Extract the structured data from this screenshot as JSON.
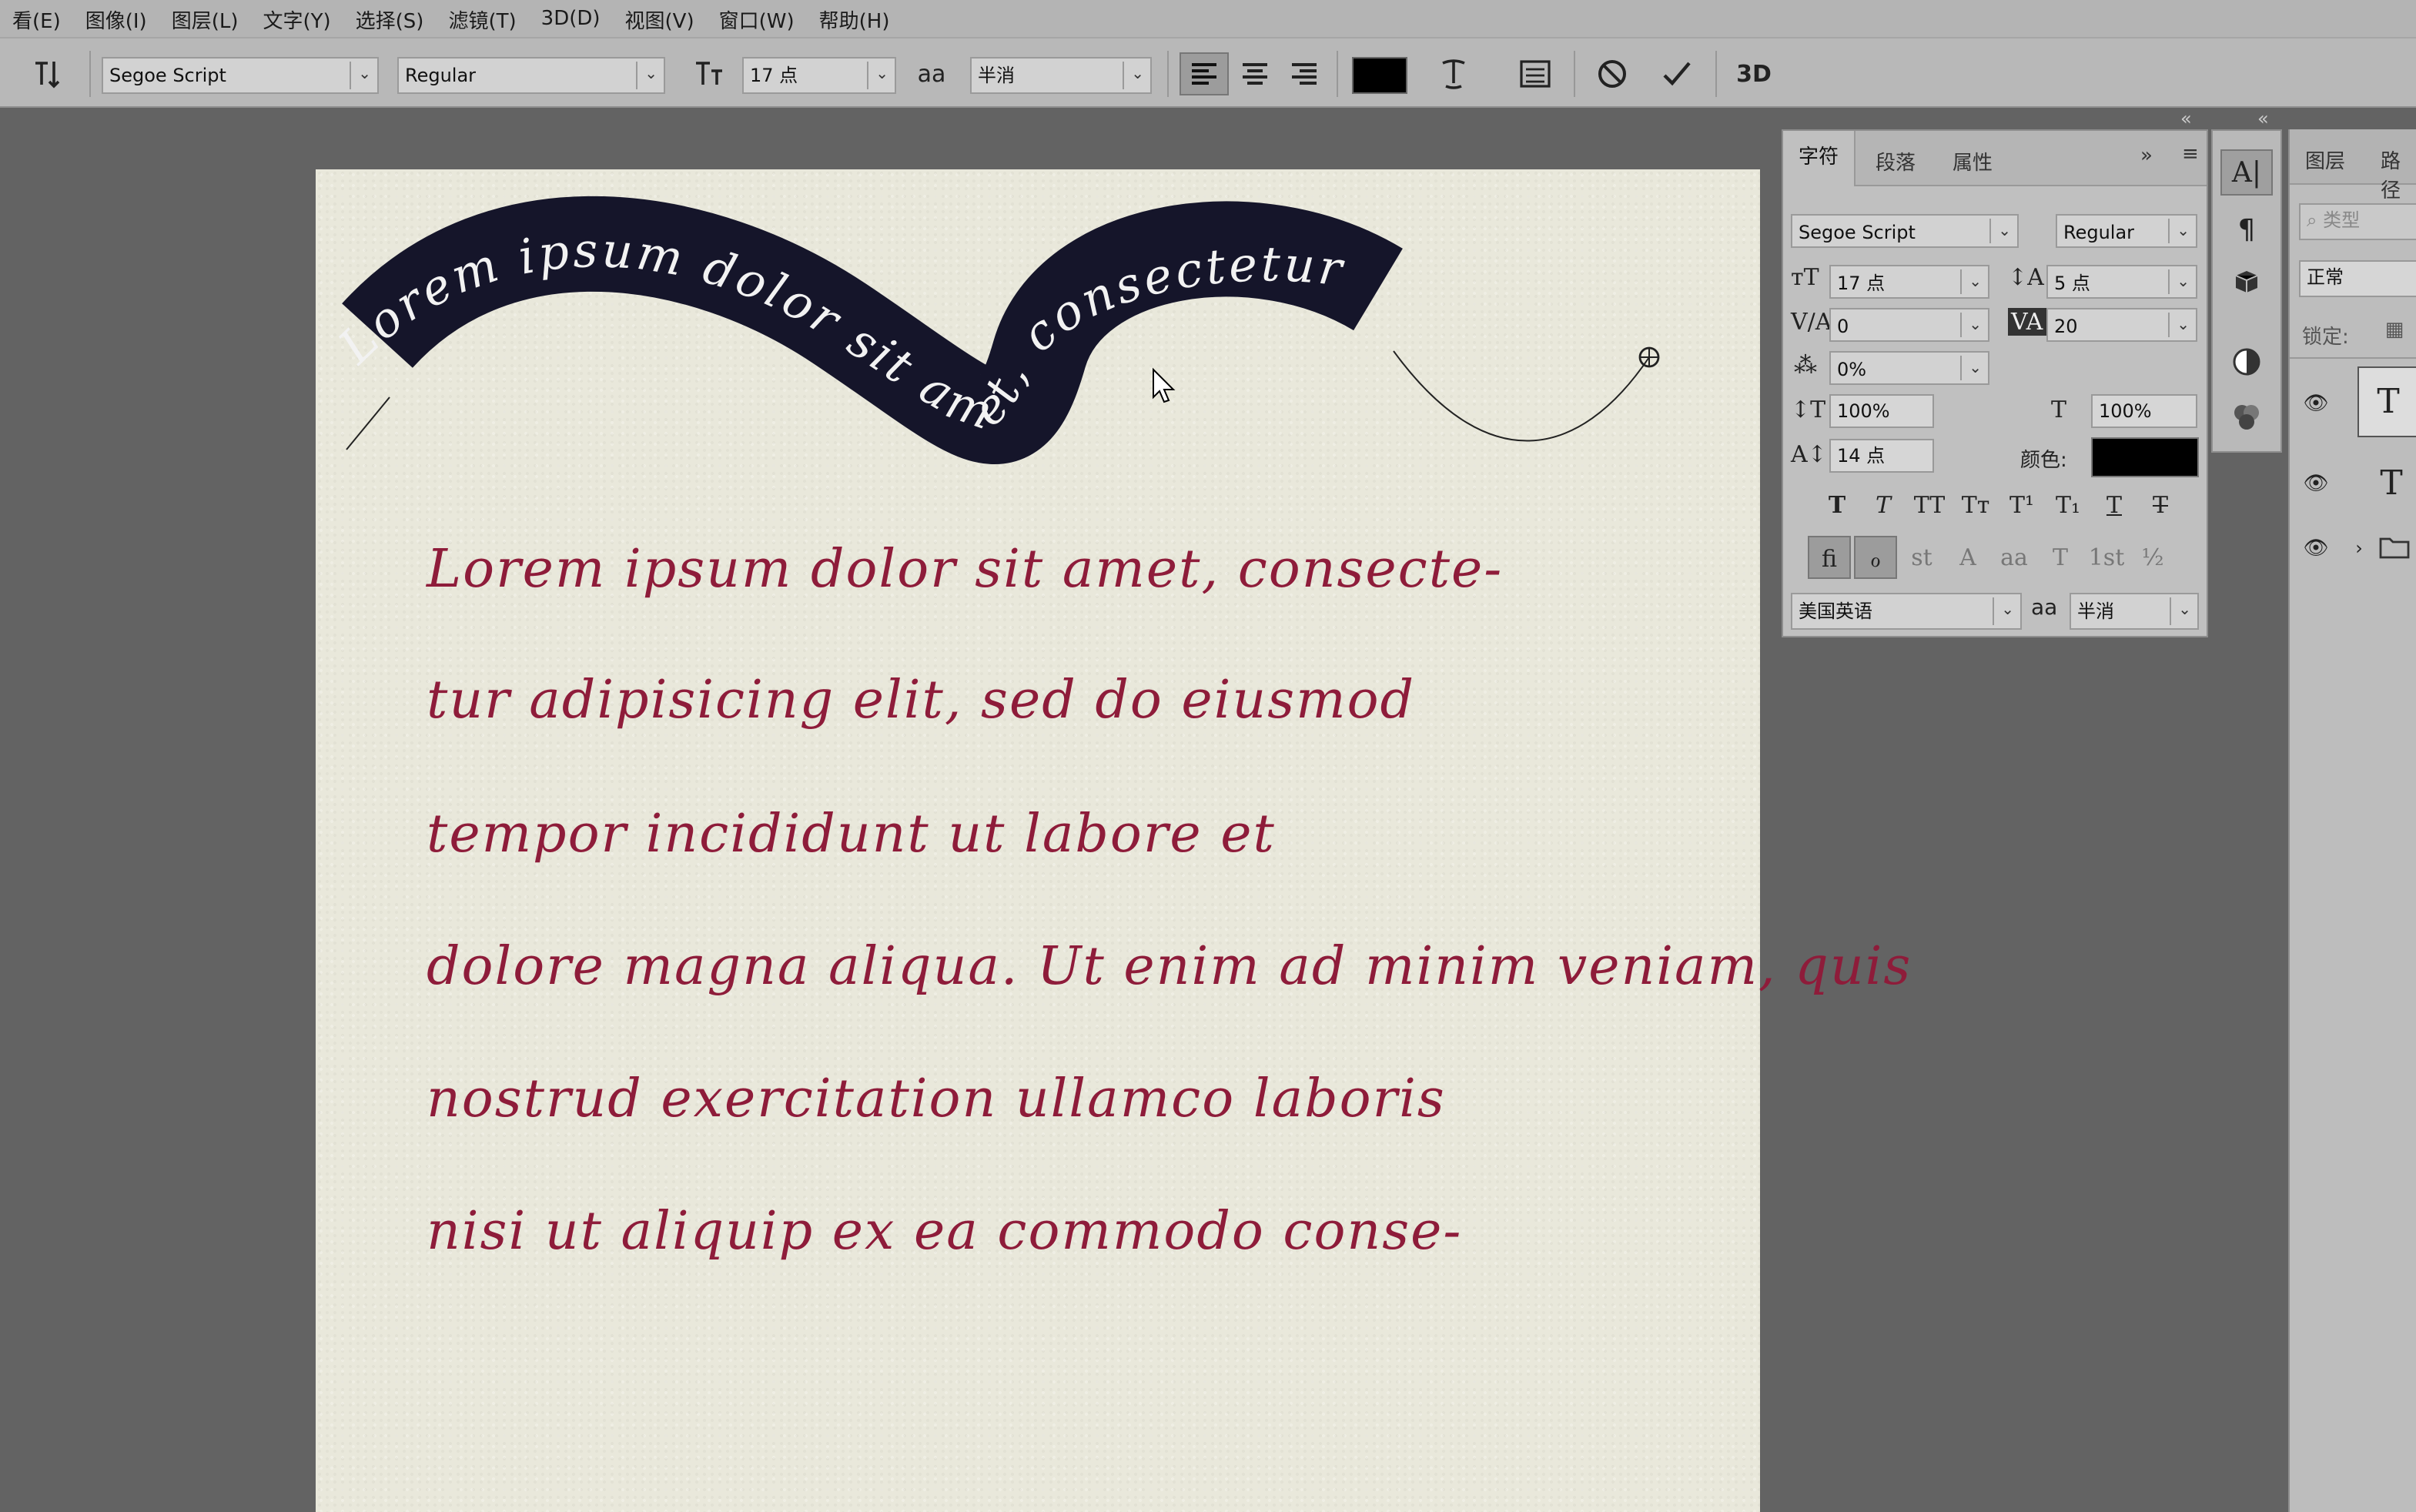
{
  "menu": [
    "看(E)",
    "图像(I)",
    "图层(L)",
    "文字(Y)",
    "选择(S)",
    "滤镜(T)",
    "3D(D)",
    "视图(V)",
    "窗口(W)",
    "帮助(H)"
  ],
  "options": {
    "font_family": "Segoe Script",
    "font_style": "Regular",
    "font_size": "17 点",
    "aa_icon": "aa",
    "anti_alias": "半消",
    "threed": "3D"
  },
  "path_text": "Lorem ipsum dolor sit amet, consectetur",
  "body_lines": [
    "Lorem ipsum dolor sit amet, consecte-",
    "tur adipisicing elit, sed do eiusmod",
    "tempor incididunt ut labore et",
    "dolore magna aliqua. Ut enim ad minim veniam, quis",
    "nostrud exercitation ullamco laboris",
    "nisi ut aliquip ex ea commodo conse-"
  ],
  "character_panel": {
    "tabs": [
      "字符",
      "段落",
      "属性"
    ],
    "font_family": "Segoe Script",
    "font_style": "Regular",
    "size": "17 点",
    "leading": "5 点",
    "kerning": "0",
    "tracking": "20",
    "tsume": "0%",
    "vscale": "100%",
    "hscale": "100%",
    "baseline": "14 点",
    "color_label": "颜色:",
    "color": "#000000",
    "type_style_buttons": [
      "T",
      "T",
      "TT",
      "Tт",
      "T¹",
      "T₁",
      "T",
      "T"
    ],
    "opentype_buttons": [
      "fi",
      "ℴ",
      "st",
      "A",
      "aa",
      "T",
      "1st",
      "½"
    ],
    "language": "美国英语",
    "aa_icon": "aa",
    "anti_alias": "半消"
  },
  "layers_panel": {
    "tabs": [
      "图层",
      "路径"
    ],
    "filter_placeholder": "类型",
    "blend_mode": "正常",
    "lock_label": "锁定:",
    "layer_glyphs": [
      "T",
      "T",
      ""
    ]
  },
  "colors": {
    "path_band": "#15152a",
    "body_text": "#8e1c3a",
    "paper": "#e9e8db"
  }
}
